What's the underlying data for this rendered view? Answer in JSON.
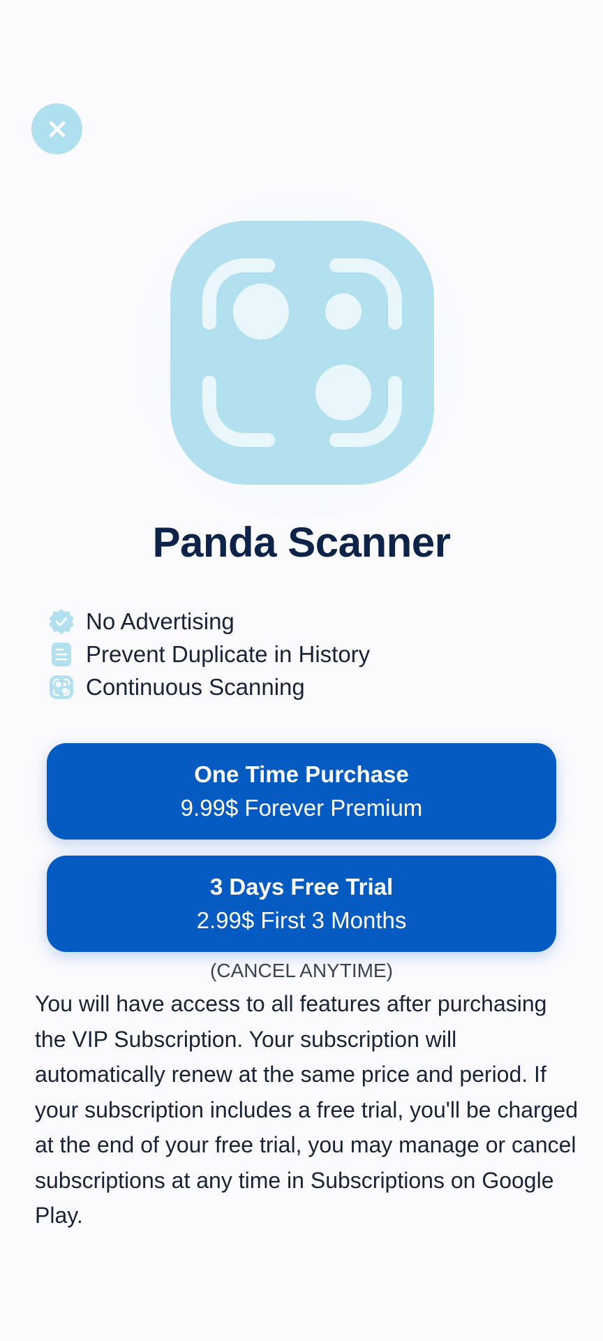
{
  "header": {
    "close_icon": "close-icon"
  },
  "app": {
    "logo_icon": "scanner-logo-icon",
    "title": "Panda Scanner"
  },
  "features": [
    {
      "icon": "verified-badge-icon",
      "label": "No Advertising"
    },
    {
      "icon": "document-list-icon",
      "label": "Prevent Duplicate in History"
    },
    {
      "icon": "scan-icon",
      "label": "Continuous Scanning"
    }
  ],
  "plans": [
    {
      "title": "One Time Purchase",
      "subtitle": "9.99$ Forever Premium"
    },
    {
      "title": "3 Days Free Trial",
      "subtitle": "2.99$ First 3 Months"
    }
  ],
  "cancel_note": "(CANCEL ANYTIME)",
  "disclaimer": "You will have access to all features after purchasing the VIP Subscription. Your subscription will automatically renew at the same price and period. If your subscription includes a free trial, you'll be charged at the end of your free trial, you may manage or cancel subscriptions at any time in Subscriptions on Google Play.",
  "colors": {
    "background": "#fbfbfe",
    "accent_light": "#b2e0ef",
    "button": "#055bc2",
    "title": "#0d2347"
  }
}
